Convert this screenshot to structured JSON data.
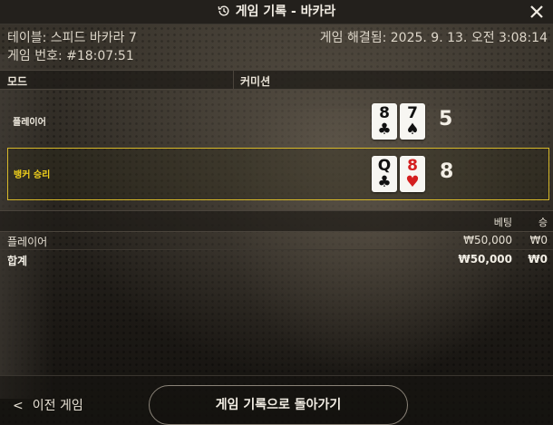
{
  "header": {
    "title": "게임 기록 - 바카라",
    "history_icon": "history-clock-icon",
    "close_icon": "close-icon"
  },
  "info": {
    "table": "테이블: 스피드 바카라 7",
    "game_number": "게임 번호: #18:07:51",
    "settled": "게임 해결됨: 2025. 9. 13. 오전 3:08:14"
  },
  "columns": {
    "mode": "모드",
    "commission": "커미션"
  },
  "hands": {
    "player": {
      "label": "플레이어",
      "score": "5",
      "cards": [
        {
          "rank": "8",
          "suit": "♣",
          "color": "#111111"
        },
        {
          "rank": "7",
          "suit": "♠",
          "color": "#111111"
        }
      ]
    },
    "banker": {
      "label": "뱅커 승리",
      "score": "8",
      "cards": [
        {
          "rank": "Q",
          "suit": "♣",
          "color": "#111111"
        },
        {
          "rank": "8",
          "suit": "♥",
          "color": "#d41f1f"
        }
      ]
    },
    "win_color": "#f2d21c"
  },
  "bets": {
    "headers": {
      "bet": "베팅",
      "win": "승"
    },
    "rows": [
      {
        "name": "플레이어",
        "bet": "₩50,000",
        "win": "₩0"
      }
    ],
    "total": {
      "name": "합계",
      "bet": "₩50,000",
      "win": "₩0"
    }
  },
  "footer": {
    "prev_label": "이전 게임",
    "back_label": "게임 기록으로 돌아가기"
  }
}
